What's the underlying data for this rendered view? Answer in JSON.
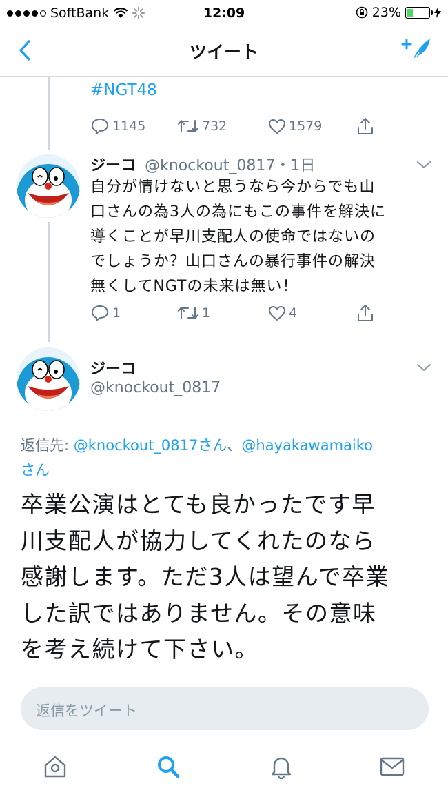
{
  "status_bar": {
    "carrier": "SoftBank",
    "time": "12:09",
    "battery": "23%",
    "battery_level": 0.23,
    "icons": [
      "signal-dots",
      "wifi-icon",
      "loading-spinner-icon",
      "rotation-lock-icon",
      "battery-icon",
      "charging-bolt-icon"
    ]
  },
  "nav": {
    "title": "ツイート",
    "back_icon": "chevron-left-icon",
    "compose_icon": "compose-tweet-icon"
  },
  "prev_tweet": {
    "hashtag": "#NGT48",
    "replies": "1145",
    "retweets": "732",
    "likes": "1579"
  },
  "reply_tweet": {
    "name": "ジーコ",
    "handle": "@knockout_0817",
    "time": "・1日",
    "lines": [
      "自分が情けないと思うなら今からでも山",
      "口さんの為3人の為にもこの事件を解決に",
      "導くことが早川支配人の使命ではないの",
      "でしょうか？山口さんの暴行事件の解決",
      "無くしてNGTの未来は無い！"
    ],
    "replies": "1",
    "retweets": "1",
    "likes": "4"
  },
  "main_tweet": {
    "name": "ジーコ",
    "handle": "@knockout_0817",
    "reply_prefix": "返信先: ",
    "reply_user1": "@knockout_0817さん",
    "reply_sep": "、",
    "reply_user2": "@hayakawamaiko",
    "reply_user2_suffix": "さん",
    "lines": [
      "卒業公演はとても良かったです早",
      "川支配人が協力してくれたのなら",
      "感謝します。ただ3人は望んで卒業",
      "した訳ではありません。その意味",
      "を考え続けて下さい。"
    ]
  },
  "reply_box": {
    "placeholder": "返信をツイート"
  },
  "tabs": [
    "home-icon",
    "search-icon",
    "notifications-icon",
    "messages-icon"
  ],
  "colors": {
    "accent": "#1da1f2",
    "secondary_text": "#657786",
    "divider": "#e1e8ed"
  }
}
